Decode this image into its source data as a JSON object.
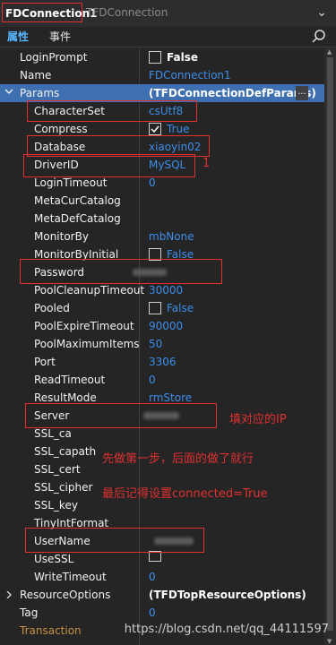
{
  "header": {
    "component_name": "FDConnection1",
    "component_type": "TFDConnection"
  },
  "tabs": {
    "properties": "属性",
    "events": "事件"
  },
  "rows": {
    "loginprompt": {
      "name": "LoginPrompt",
      "value": "False"
    },
    "name": {
      "name": "Name",
      "value": "FDConnection1"
    },
    "params": {
      "name": "Params",
      "value": "(TFDConnectionDefParams)",
      "button": "..."
    },
    "characterset": {
      "name": "CharacterSet",
      "value": "csUtf8"
    },
    "compress": {
      "name": "Compress",
      "value": "True"
    },
    "database": {
      "name": "Database",
      "value": "xiaoyin02"
    },
    "driverid": {
      "name": "DriverID",
      "value": "MySQL"
    },
    "logintimeout": {
      "name": "LoginTimeout",
      "value": "0"
    },
    "metacurcatalog": {
      "name": "MetaCurCatalog",
      "value": ""
    },
    "metadefcatalog": {
      "name": "MetaDefCatalog",
      "value": ""
    },
    "monitorby": {
      "name": "MonitorBy",
      "value": "mbNone"
    },
    "monitorbyinitial": {
      "name": "MonitorByInitial",
      "value": "False"
    },
    "password": {
      "name": "Password",
      "value": ""
    },
    "poolcleanuptimeout": {
      "name": "PoolCleanupTimeout",
      "value": "30000"
    },
    "pooled": {
      "name": "Pooled",
      "value": "False"
    },
    "poolexpiretimeout": {
      "name": "PoolExpireTimeout",
      "value": "90000"
    },
    "poolmaximumitems": {
      "name": "PoolMaximumItems",
      "value": "50"
    },
    "port": {
      "name": "Port",
      "value": "3306"
    },
    "readtimeout": {
      "name": "ReadTimeout",
      "value": "0"
    },
    "resultmode": {
      "name": "ResultMode",
      "value": "rmStore"
    },
    "server": {
      "name": "Server",
      "value": ""
    },
    "ssl_ca": {
      "name": "SSL_ca",
      "value": ""
    },
    "ssl_capath": {
      "name": "SSL_capath",
      "value": ""
    },
    "ssl_cert": {
      "name": "SSL_cert",
      "value": ""
    },
    "ssl_cipher": {
      "name": "SSL_cipher",
      "value": ""
    },
    "ssl_key": {
      "name": "SSL_key",
      "value": ""
    },
    "tinyintformat": {
      "name": "TinyIntFormat",
      "value": ""
    },
    "username": {
      "name": "UserName",
      "value": ""
    },
    "usessl": {
      "name": "UseSSL",
      "value": ""
    },
    "writetimeout": {
      "name": "WriteTimeout",
      "value": "0"
    },
    "resourceoptions": {
      "name": "ResourceOptions",
      "value": "(TFDTopResourceOptions)"
    },
    "tag": {
      "name": "Tag",
      "value": "0"
    },
    "transaction": {
      "name": "Transaction",
      "value": ""
    }
  },
  "annotations": {
    "number": "1",
    "ip_note": "填对应的IP",
    "step_note": "先做第一步，后面的做了就行",
    "connected_note": "最后记得设置connected=True"
  },
  "watermark": "https://blog.csdn.net/qq_44111597",
  "colors": {
    "accent_blue": "#3b8eea",
    "annotation_red": "#e03030",
    "selected_row": "#3e6fb0"
  }
}
